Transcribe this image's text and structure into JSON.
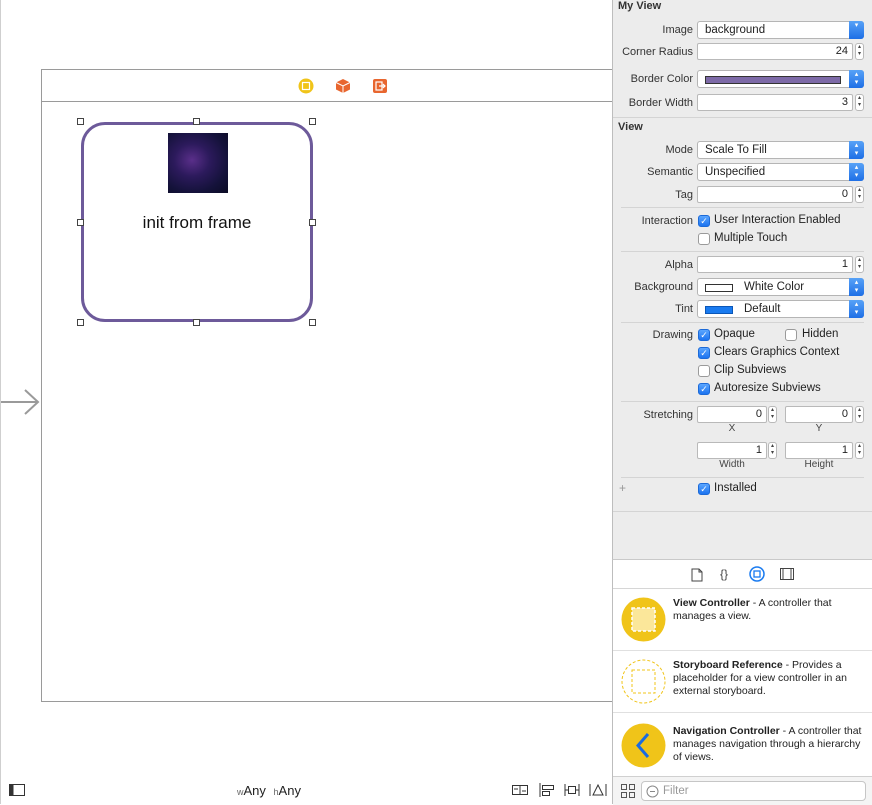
{
  "canvas": {
    "view_label": "init from frame",
    "size_class_w_prefix": "w",
    "size_class_w": "Any",
    "size_class_h_prefix": "h",
    "size_class_h": "Any",
    "scene_icons": [
      "view-controller-icon",
      "first-responder-icon",
      "exit-icon"
    ],
    "colors": {
      "border": "#6d5a9a",
      "icon_yellow": "#f0c419",
      "icon_orange": "#e8662f"
    }
  },
  "inspector": {
    "my_view": {
      "title": "My View",
      "image_label": "Image",
      "image_value": "background",
      "corner_radius_label": "Corner Radius",
      "corner_radius_value": "24",
      "border_color_label": "Border Color",
      "border_color_value": "#7d6aa7",
      "border_width_label": "Border Width",
      "border_width_value": "3"
    },
    "view": {
      "title": "View",
      "mode_label": "Mode",
      "mode_value": "Scale To Fill",
      "semantic_label": "Semantic",
      "semantic_value": "Unspecified",
      "tag_label": "Tag",
      "tag_value": "0",
      "interaction_label": "Interaction",
      "user_interaction": {
        "label": "User Interaction Enabled",
        "checked": true
      },
      "multiple_touch": {
        "label": "Multiple Touch",
        "checked": false
      },
      "alpha_label": "Alpha",
      "alpha_value": "1",
      "background_label": "Background",
      "background_value": "White Color",
      "tint_label": "Tint",
      "tint_value": "Default",
      "tint_color": "#1a7bf0",
      "drawing_label": "Drawing",
      "opaque": {
        "label": "Opaque",
        "checked": true
      },
      "hidden": {
        "label": "Hidden",
        "checked": false
      },
      "clears_graphics": {
        "label": "Clears Graphics Context",
        "checked": true
      },
      "clip_subviews": {
        "label": "Clip Subviews",
        "checked": false
      },
      "autoresize": {
        "label": "Autoresize Subviews",
        "checked": true
      },
      "stretching_label": "Stretching",
      "stretch_x": "0",
      "stretch_y": "0",
      "stretch_x_label": "X",
      "stretch_y_label": "Y",
      "stretch_w": "1",
      "stretch_h": "1",
      "stretch_w_label": "Width",
      "stretch_h_label": "Height",
      "plus": "+",
      "installed": {
        "label": "Installed",
        "checked": true
      }
    }
  },
  "library": {
    "tabs": [
      "file-template-icon",
      "code-snippet-icon",
      "object-library-icon",
      "media-library-icon"
    ],
    "items": [
      {
        "title": "View Controller",
        "desc": " - A controller that manages a view."
      },
      {
        "title": "Storyboard Reference",
        "desc": " - Provides a placeholder for a view controller in an external storyboard."
      },
      {
        "title": "Navigation Controller",
        "desc": " - A controller that manages navigation through a hierarchy of views."
      }
    ],
    "filter_placeholder": "Filter"
  }
}
